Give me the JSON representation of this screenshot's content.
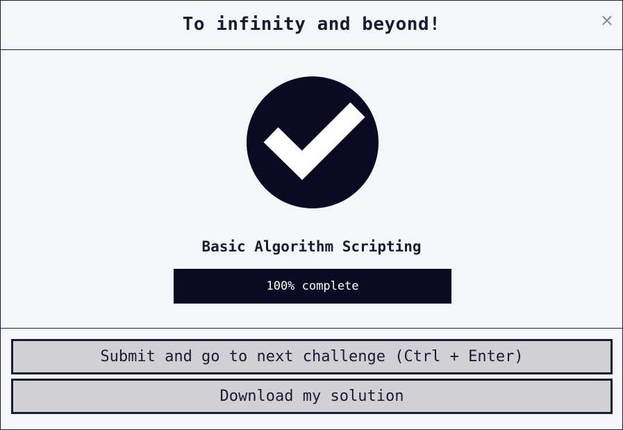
{
  "modal": {
    "title": "To infinity and beyond!",
    "close_label": "×"
  },
  "completion": {
    "icon": "check-circle-icon",
    "block_title": "Basic Algorithm Scripting",
    "progress_text": "100% complete",
    "progress_fraction": 1.0
  },
  "actions": {
    "submit_label": "Submit and go to next challenge (Ctrl + Enter)",
    "download_label": "Download my solution"
  },
  "colors": {
    "dark": "#0a0a23",
    "border": "#1b1b32",
    "button_bg": "#d0d0d5",
    "background": "#f5f6f7"
  }
}
